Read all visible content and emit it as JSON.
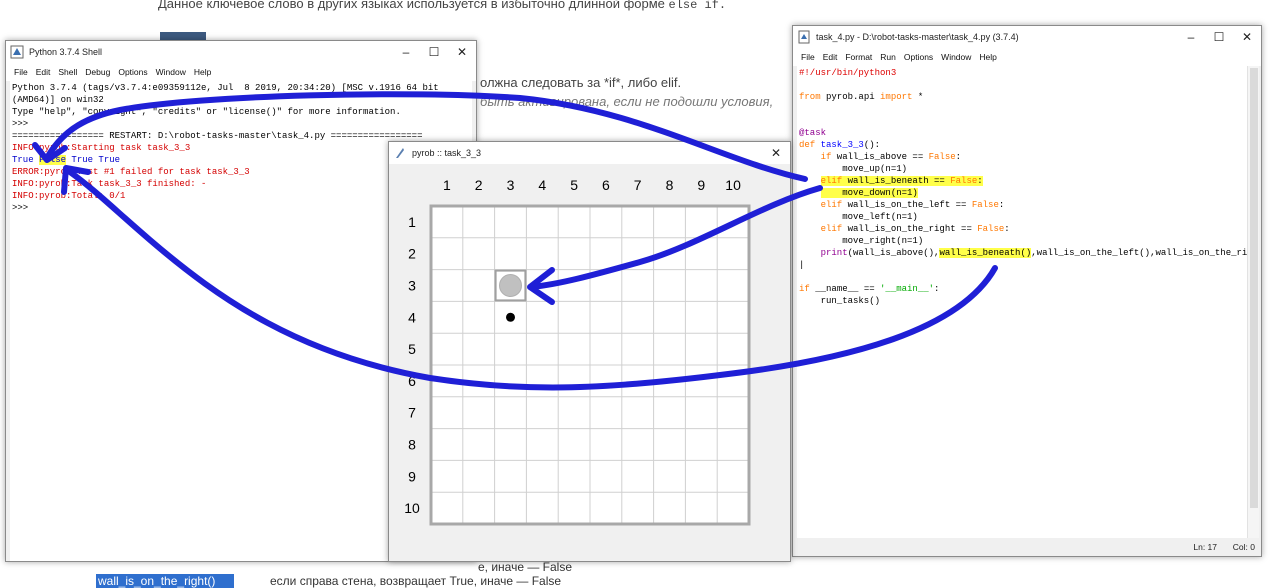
{
  "background_page": {
    "heading_text": "Данное ключевое слово в других языках используется в избыточно длинной форме",
    "heading_code": "else if.",
    "line1": "олжна следовать за *if*, либо elif.",
    "line2": "быть активирована, если не подошли условия,",
    "bottom_line1": "е, иначе — False",
    "bottom_line2": "если справа стена, возвращает True, иначе — False",
    "selected_function": "wall_is_on_the_right()"
  },
  "shell_window": {
    "title": "Python 3.7.4 Shell",
    "menu": [
      "File",
      "Edit",
      "Shell",
      "Debug",
      "Options",
      "Window",
      "Help"
    ],
    "lines": [
      {
        "text": "Python 3.7.4 (tags/v3.7.4:e09359112e, Jul  8 2019, 20:34:20) [MSC v.1916 64 bit",
        "color": "black"
      },
      {
        "text": "(AMD64)] on win32",
        "color": "black"
      },
      {
        "text": "Type \"help\", \"copyright\", \"credits\" or \"license()\" for more information.",
        "color": "black"
      },
      {
        "text": ">>> ",
        "color": "black"
      },
      {
        "text": "================= RESTART: D:\\robot-tasks-master\\task_4.py =================",
        "color": "black"
      },
      {
        "text": "INFO:pyrob:Starting task task_3_3",
        "color": "red"
      },
      {
        "text": "ERROR:pyrob:Test #1 failed for task task_3_3",
        "color": "red"
      },
      {
        "text": "INFO:pyrob:Task task_3_3 finished: -",
        "color": "red"
      },
      {
        "text": "INFO:pyrob:Total: 0/1",
        "color": "red"
      },
      {
        "text": ">>> ",
        "color": "black"
      }
    ],
    "print_line": {
      "part1": "True ",
      "highlighted": "False",
      "part2": " True True"
    }
  },
  "robot_window": {
    "title": "pyrob :: task_3_3",
    "columns": [
      "1",
      "2",
      "3",
      "4",
      "5",
      "6",
      "7",
      "8",
      "9",
      "10"
    ],
    "rows": [
      "1",
      "2",
      "3",
      "4",
      "5",
      "6",
      "7",
      "8",
      "9",
      "10"
    ],
    "robot_cell": {
      "row": 3,
      "col": 3
    },
    "marker_cell": {
      "row": 4,
      "col": 3
    },
    "colors": {
      "grid": "#d0d0d0",
      "border": "#a8a8a8",
      "robot": "#c0c0c0",
      "marker": "#000000"
    }
  },
  "editor_window": {
    "title": "task_4.py - D:\\robot-tasks-master\\task_4.py (3.7.4)",
    "menu": [
      "File",
      "Edit",
      "Format",
      "Run",
      "Options",
      "Window",
      "Help"
    ],
    "status_line": "Ln: 17",
    "status_col": "Col: 0",
    "code": {
      "shebang": "#!/usr/bin/python3",
      "import_from": "from",
      "import_mod": " pyrob.api ",
      "import_kw": "import",
      "import_rest": " *",
      "decorator": "@task",
      "def_kw": "def",
      "def_name": " task_3_3",
      "def_rest": "():",
      "if1_kw": "    if",
      "if1_cond": " wall_is_above == ",
      "if1_false": "False",
      "if1_colon": ":",
      "move_up": "        move_up(n=1)",
      "elif1_kw": "elif",
      "elif1_cond": " wall_is_beneath == ",
      "elif1_false": "False",
      "elif1_colon": ":",
      "move_down": "    move_down(n=1)",
      "elif2_kw": "    elif",
      "elif2_cond": " wall_is_on_the_left == ",
      "elif2_false": "False",
      "elif2_colon": ":",
      "move_left": "        move_left(n=1)",
      "elif3_kw": "    elif",
      "elif3_cond": " wall_is_on_the_right == ",
      "elif3_false": "False",
      "elif3_colon": ":",
      "move_right": "        move_right(n=1)",
      "print_kw": "    print",
      "print_a": "(wall_is_above(),",
      "print_hl": "wall_is_beneath()",
      "print_b": ",wall_is_on_the_left(),wall_is_on_the_right())",
      "main_if": "if",
      "main_cond": " __name__ == ",
      "main_str": "'__main__'",
      "main_colon": ":",
      "run": "    run_tasks()"
    }
  },
  "annotation": {
    "arrow_color": "#1f1fd6",
    "highlight_color": "#ffff4a"
  }
}
